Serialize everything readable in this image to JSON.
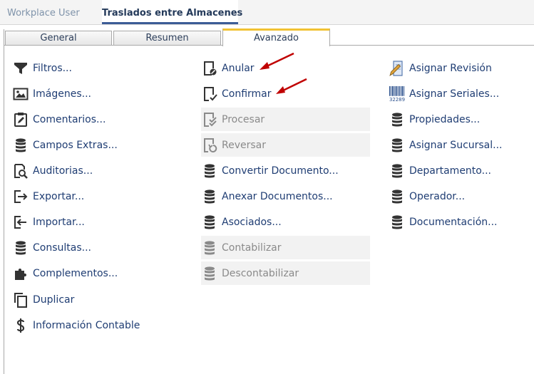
{
  "window": {
    "app_tab": "Workplace User",
    "doc_tab": "Traslados entre Almacenes"
  },
  "tabs": [
    {
      "label": "General",
      "active": false
    },
    {
      "label": "Resumen",
      "active": false
    },
    {
      "label": "Avanzado",
      "active": true
    }
  ],
  "colors": {
    "link": "#1f3d73",
    "disabled_text": "#8a8a8a",
    "active_tab_accent": "#f1c232",
    "annotation_arrow": "#c00000"
  },
  "actions": {
    "col1": [
      {
        "label": "Filtros...",
        "icon": "filter-icon"
      },
      {
        "label": "Imágenes...",
        "icon": "image-icon"
      },
      {
        "label": "Comentarios...",
        "icon": "clipboard-edit-icon"
      },
      {
        "label": "Campos Extras...",
        "icon": "database-icon"
      },
      {
        "label": "Auditorias...",
        "icon": "audit-search-icon"
      },
      {
        "label": "Exportar...",
        "icon": "export-icon"
      },
      {
        "label": "Importar...",
        "icon": "import-icon"
      },
      {
        "label": "Consultas...",
        "icon": "database-icon"
      },
      {
        "label": "Complementos...",
        "icon": "puzzle-icon"
      },
      {
        "label": "Duplicar",
        "icon": "copy-icon"
      },
      {
        "label": "Información Contable",
        "icon": "dollar-icon"
      }
    ],
    "col2": [
      {
        "label": "Anular",
        "icon": "document-void-icon",
        "enabled": true
      },
      {
        "label": "Confirmar",
        "icon": "document-check-icon",
        "enabled": true
      },
      {
        "label": "Procesar",
        "icon": "document-process-icon",
        "enabled": false
      },
      {
        "label": "Reversar",
        "icon": "document-undo-icon",
        "enabled": false
      },
      {
        "label": "Convertir Documento...",
        "icon": "database-icon",
        "enabled": true
      },
      {
        "label": "Anexar Documentos...",
        "icon": "database-icon",
        "enabled": true
      },
      {
        "label": "Asociados...",
        "icon": "database-icon",
        "enabled": true
      },
      {
        "label": "Contabilizar",
        "icon": "database-icon",
        "enabled": false
      },
      {
        "label": "Descontabilizar",
        "icon": "database-icon",
        "enabled": false
      }
    ],
    "col3": [
      {
        "label": "Asignar Revisión",
        "icon": "document-pen-icon"
      },
      {
        "label": "Asignar Seriales...",
        "icon": "barcode-icon",
        "barcode_text": "32289"
      },
      {
        "label": "Propiedades...",
        "icon": "database-icon"
      },
      {
        "label": "Asignar Sucursal...",
        "icon": "database-icon"
      },
      {
        "label": "Departamento...",
        "icon": "database-icon"
      },
      {
        "label": "Operador...",
        "icon": "database-icon"
      },
      {
        "label": "Documentación...",
        "icon": "database-icon"
      }
    ]
  }
}
